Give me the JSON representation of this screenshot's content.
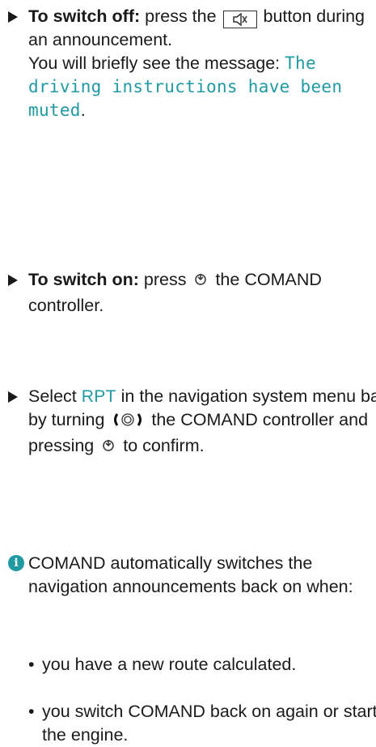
{
  "steps": [
    {
      "bold": "To switch off:",
      "before": " press the ",
      "key_icon": "mute-speaker-icon",
      "after": " button during an announcement.",
      "line2": "You will briefly see the message: ",
      "display_msg": "The driving instructions have been muted",
      "period": "."
    },
    {
      "bold": "To switch on:",
      "before": " press ",
      "ctl_icon": "press-controller-icon",
      "after": " the COMAND controller."
    },
    {
      "before": "Select ",
      "display_word": "RPT",
      "mid": " in the navigation system menu bar by turning ",
      "turn_icon": "turn-controller-icon",
      "mid2": " the COMAND controller and pressing ",
      "ctl_icon": "press-controller-icon",
      "after": " to confirm."
    }
  ],
  "note": {
    "icon": "info-icon",
    "icon_glyph": "i",
    "text": "COMAND automatically switches the navigation announcements back on when:",
    "bullets": [
      "you have a new route calculated.",
      "you switch COMAND back on again or start the engine."
    ],
    "bullet_char": "•"
  },
  "colors": {
    "display_text": "#1f9aa3",
    "info_icon": "#1f9aa3"
  }
}
